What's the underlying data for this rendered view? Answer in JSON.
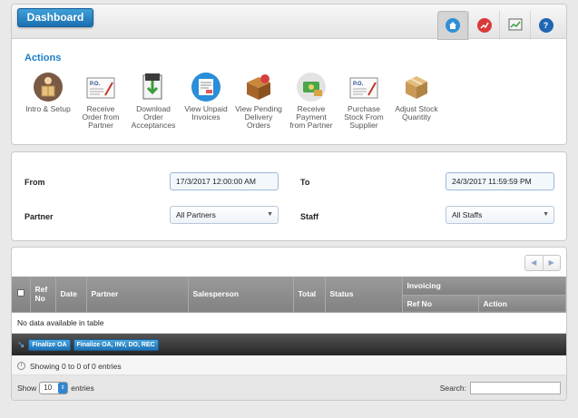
{
  "header": {
    "dashboard_label": "Dashboard",
    "top_icons": [
      "home-icon",
      "chart-icon",
      "report-icon",
      "help-icon"
    ],
    "help_glyph": "?"
  },
  "actions": {
    "title": "Actions",
    "items": [
      {
        "line1": "Intro & Setup",
        "line2": "",
        "line3": "",
        "icon": "box-person-icon"
      },
      {
        "line1": "Receive",
        "line2": "Order from",
        "line3": "Partner",
        "icon": "po-document-icon"
      },
      {
        "line1": "Download",
        "line2": "Order",
        "line3": "Acceptances",
        "icon": "download-icon"
      },
      {
        "line1": "View Unpaid",
        "line2": "Invoices",
        "line3": "",
        "icon": "invoice-icon"
      },
      {
        "line1": "View Pending",
        "line2": "Delivery",
        "line3": "Orders",
        "icon": "delivery-box-icon"
      },
      {
        "line1": "Receive",
        "line2": "Payment",
        "line3": "from Partner",
        "icon": "payment-icon"
      },
      {
        "line1": "Purchase",
        "line2": "Stock From",
        "line3": "Supplier",
        "icon": "po-document-icon"
      },
      {
        "line1": "Adjust Stock",
        "line2": "Quantity",
        "line3": "",
        "icon": "stock-box-icon"
      }
    ],
    "po_text": "P.O."
  },
  "filters": {
    "from_label": "From",
    "from_value": "17/3/2017 12:00:00 AM",
    "to_label": "To",
    "to_value": "24/3/2017 11:59:59 PM",
    "partner_label": "Partner",
    "partner_value": "All Partners",
    "staff_label": "Staff",
    "staff_value": "All Staffs"
  },
  "table": {
    "headers": {
      "ref_no": "Ref No",
      "date": "Date",
      "partner": "Partner",
      "salesperson": "Salesperson",
      "total": "Total",
      "status": "Status",
      "invoicing": "Invoicing",
      "inv_ref_no": "Ref No",
      "inv_action": "Action"
    },
    "empty_text": "No data available in table",
    "bulk_buttons": [
      "Finalize OA",
      "Finalize OA, INV, DO, REC"
    ],
    "info_text": "Showing 0 to 0 of 0 entries",
    "show_label": "Show",
    "page_length": "10",
    "entries_label": "entries",
    "search_label": "Search:"
  }
}
